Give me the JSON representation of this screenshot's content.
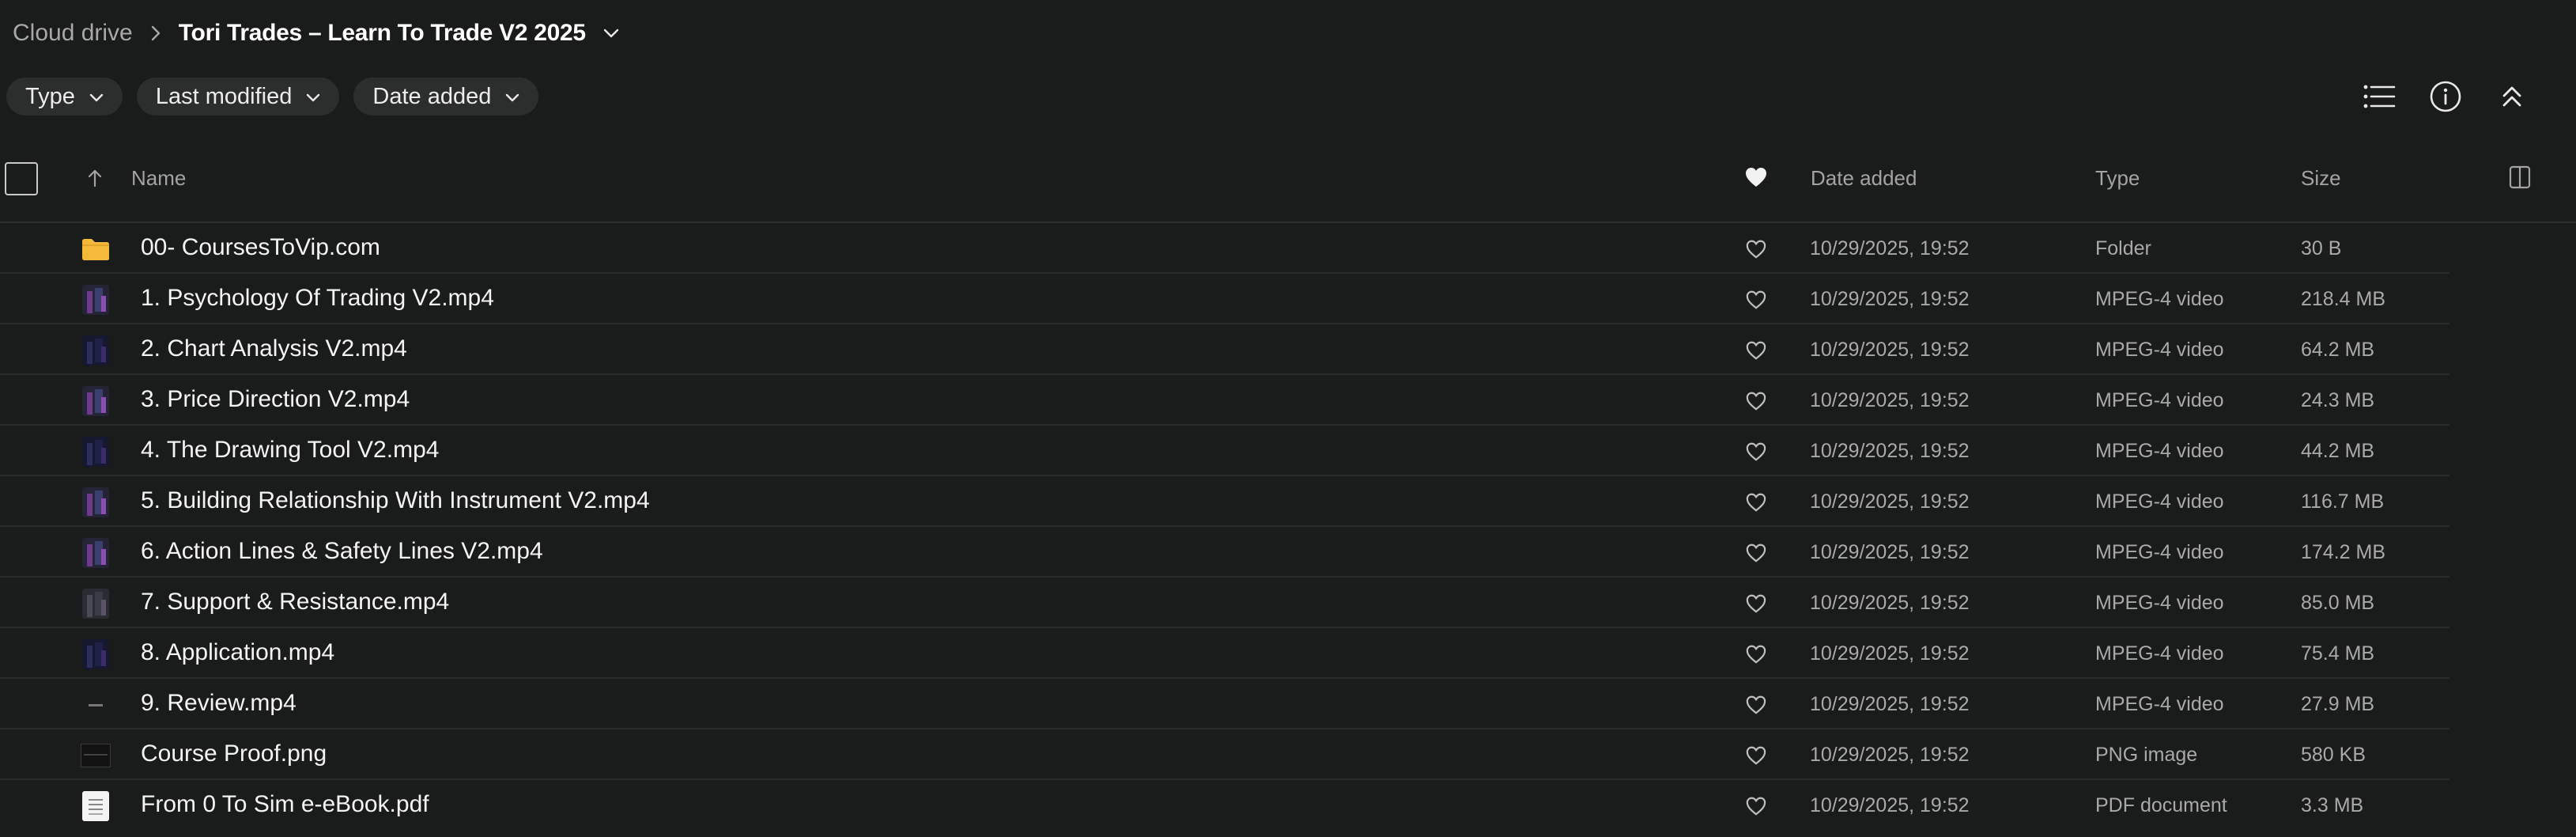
{
  "breadcrumb": {
    "root": "Cloud drive",
    "current": "Tori Trades – Learn To Trade V2 2025"
  },
  "filters": [
    {
      "label": "Type"
    },
    {
      "label": "Last modified"
    },
    {
      "label": "Date added"
    }
  ],
  "toolbar": {
    "icons": [
      "list-view-icon",
      "info-icon",
      "collapse-icon"
    ]
  },
  "table": {
    "columns": {
      "name": "Name",
      "date_added": "Date added",
      "type": "Type",
      "size": "Size"
    },
    "rows": [
      {
        "name": "00- CoursesToVip.com",
        "date": "10/29/2025, 19:52",
        "type": "Folder",
        "size": "30 B",
        "thumb": "folder"
      },
      {
        "name": "1. Psychology Of Trading V2.mp4",
        "date": "10/29/2025, 19:52",
        "type": "MPEG-4 video",
        "size": "218.4 MB",
        "thumb": "video"
      },
      {
        "name": "2. Chart Analysis V2.mp4",
        "date": "10/29/2025, 19:52",
        "type": "MPEG-4 video",
        "size": "64.2 MB",
        "thumb": "video-dark"
      },
      {
        "name": "3. Price Direction V2.mp4",
        "date": "10/29/2025, 19:52",
        "type": "MPEG-4 video",
        "size": "24.3 MB",
        "thumb": "video"
      },
      {
        "name": "4. The Drawing Tool V2.mp4",
        "date": "10/29/2025, 19:52",
        "type": "MPEG-4 video",
        "size": "44.2 MB",
        "thumb": "video-dark"
      },
      {
        "name": "5. Building Relationship With Instrument V2.mp4",
        "date": "10/29/2025, 19:52",
        "type": "MPEG-4 video",
        "size": "116.7 MB",
        "thumb": "video"
      },
      {
        "name": "6. Action Lines & Safety Lines V2.mp4",
        "date": "10/29/2025, 19:52",
        "type": "MPEG-4 video",
        "size": "174.2 MB",
        "thumb": "video"
      },
      {
        "name": "7. Support & Resistance.mp4",
        "date": "10/29/2025, 19:52",
        "type": "MPEG-4 video",
        "size": "85.0 MB",
        "thumb": "video-grey"
      },
      {
        "name": "8. Application.mp4",
        "date": "10/29/2025, 19:52",
        "type": "MPEG-4 video",
        "size": "75.4 MB",
        "thumb": "video-dark"
      },
      {
        "name": "9. Review.mp4",
        "date": "10/29/2025, 19:52",
        "type": "MPEG-4 video",
        "size": "27.9 MB",
        "thumb": "video-tiny"
      },
      {
        "name": "Course Proof.png",
        "date": "10/29/2025, 19:52",
        "type": "PNG image",
        "size": "580 KB",
        "thumb": "png"
      },
      {
        "name": "From 0 To Sim e-eBook.pdf",
        "date": "10/29/2025, 19:52",
        "type": "PDF document",
        "size": "3.3 MB",
        "thumb": "pdf"
      }
    ]
  },
  "colors": {
    "background": "#1a1b1b",
    "chip": "#2c2d2d",
    "folder": "#f5b93a"
  }
}
